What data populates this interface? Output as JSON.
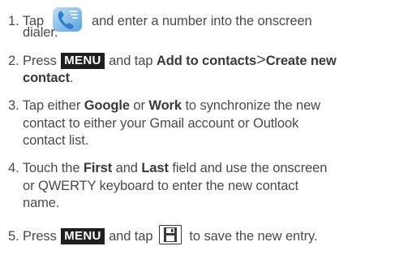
{
  "steps": [
    {
      "num": "1.",
      "lines": [
        "Tap",
        "and enter a number into the onscreen",
        "dialer."
      ]
    },
    {
      "num": "2.",
      "press": "Press",
      "menu": "MENU",
      "tap": "and tap",
      "bold1": "Add to contacts",
      "sep": ">",
      "bold2": "Create new",
      "bold3": "contact",
      "period": "."
    },
    {
      "num": "3.",
      "tap": "Tap either",
      "bold1": "Google",
      "or": "or",
      "bold2": "Work",
      "rest1": "to synchronize the new",
      "line2": "contact to either your Gmail account or Outlook",
      "line3": "contact list."
    },
    {
      "num": "4.",
      "touch": "Touch the",
      "bold1": "First",
      "and": "and",
      "bold2": "Last",
      "rest1": "field and use the onscreen",
      "line2": "or QWERTY keyboard to enter the new contact",
      "line3": "name."
    },
    {
      "num": "5.",
      "press": "Press",
      "menu": "MENU",
      "tap": "and tap",
      "rest": "to save the new entry."
    }
  ],
  "icons": {
    "phone": "phone-dialer-icon",
    "save": "save-floppy-icon"
  },
  "colors": {
    "text": "#4a4a4a",
    "badge_bg": "#1f1f1f",
    "phone_blue": "#2f7fd0"
  }
}
